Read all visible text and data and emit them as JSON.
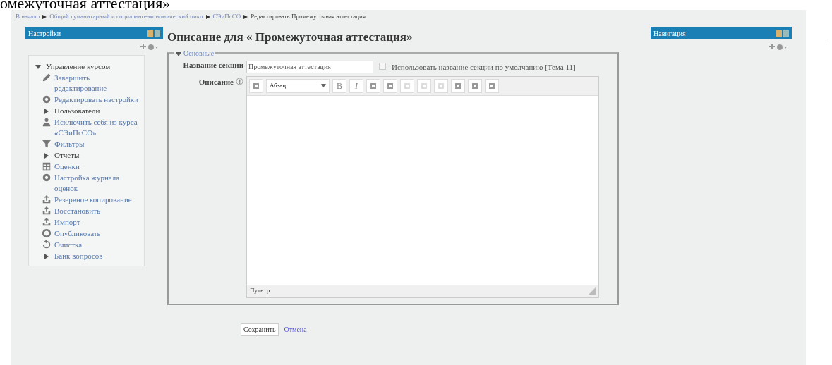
{
  "document_text": "омежуточная аттестация»",
  "breadcrumb": [
    {
      "label": "В начало",
      "link": true
    },
    {
      "label": "Общий гуманитарный и социально-экономический цикл",
      "link": true
    },
    {
      "label": "СЭиПсСО",
      "link": true
    },
    {
      "label": "Редактировать Промежуточная аттестация",
      "link": false
    }
  ],
  "settings_block": {
    "title": "Настройки",
    "tree": [
      {
        "label": "Управление курсом",
        "kind": "branch",
        "expanded": true,
        "children": [
          {
            "label": "Завершить редактирование",
            "kind": "link"
          },
          {
            "label": "Редактировать настройки",
            "kind": "link"
          },
          {
            "label": "Пользователи",
            "kind": "branch",
            "expanded": false
          },
          {
            "label": "Исключить себя из курса «СЭиПсСО»",
            "kind": "link"
          },
          {
            "label": "Фильтры",
            "kind": "link"
          },
          {
            "label": "Отчеты",
            "kind": "branch",
            "expanded": false
          },
          {
            "label": "Оценки",
            "kind": "link"
          },
          {
            "label": "Настройка журнала оценок",
            "kind": "link"
          },
          {
            "label": "Резервное копирование",
            "kind": "link"
          },
          {
            "label": "Восстановить",
            "kind": "link"
          },
          {
            "label": "Импорт",
            "kind": "link"
          },
          {
            "label": "Опубликовать",
            "kind": "link"
          },
          {
            "label": "Очистка",
            "kind": "link"
          },
          {
            "label": "Банк вопросов",
            "kind": "branchlink",
            "expanded": false
          }
        ]
      }
    ]
  },
  "heading": "Описание для « Промежуточная аттестация»",
  "form": {
    "legend": "Основные",
    "expanded": true,
    "name_label": "Название секции",
    "name_value": "Промежуточная аттестация",
    "use_default": false,
    "use_default_label": "Использовать название секции по умолчанию [Тема 11]",
    "description_label": "Описание",
    "format": "Абзац",
    "bold": "B",
    "italic": "I",
    "path": "Путь: p"
  },
  "buttons": {
    "save": "Сохранить",
    "cancel": "Отмена"
  },
  "navigation_block": {
    "title": "Навигация"
  }
}
